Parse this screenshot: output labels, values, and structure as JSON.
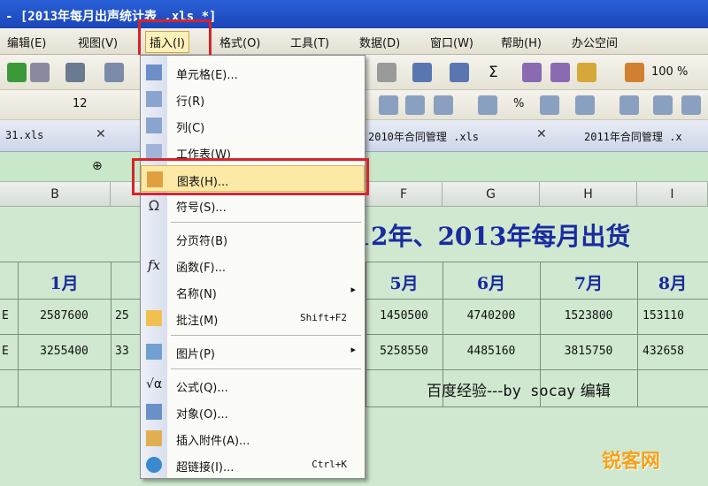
{
  "window": {
    "title": "- [2013年每月出声统计表 .xls *]"
  },
  "menubar": {
    "items": [
      "编辑(E)",
      "视图(V)",
      "插入(I)",
      "格式(O)",
      "工具(T)",
      "数据(D)",
      "窗口(W)",
      "帮助(H)",
      "办公空间"
    ]
  },
  "toolbar": {
    "sigma": "Σ",
    "zoom": "100 %",
    "font_size": "12",
    "percent": "%"
  },
  "tabs": [
    {
      "label": "31.xls"
    },
    {
      "label": "2010年合同管理 .xls"
    },
    {
      "label": "2011年合同管理 .x"
    }
  ],
  "insert_menu": {
    "items": [
      {
        "label": "单元格(E)...",
        "icon": "cells-icon"
      },
      {
        "label": "行(R)",
        "icon": "row-icon"
      },
      {
        "label": "列(C)",
        "icon": "column-icon"
      },
      {
        "label": "工作表(W)",
        "icon": "worksheet-icon"
      },
      {
        "label": "图表(H)...",
        "icon": "chart-icon",
        "highlighted": true
      },
      {
        "label": "符号(S)...",
        "icon": "omega-icon"
      },
      {
        "label": "分页符(B)",
        "icon": ""
      },
      {
        "label": "函数(F)...",
        "icon": "function-icon"
      },
      {
        "label": "名称(N)",
        "icon": "",
        "submenu": true
      },
      {
        "label": "批注(M)",
        "icon": "comment-icon",
        "shortcut": "Shift+F2"
      },
      {
        "label": "图片(P)",
        "icon": "picture-icon",
        "submenu": true
      },
      {
        "label": "公式(Q)...",
        "icon": "formula-icon"
      },
      {
        "label": "对象(O)...",
        "icon": "object-icon"
      },
      {
        "label": "插入附件(A)...",
        "icon": "attachment-icon"
      },
      {
        "label": "超链接(I)...",
        "icon": "hyperlink-icon",
        "shortcut": "Ctrl+K"
      }
    ]
  },
  "grid": {
    "columns": [
      "B",
      "F",
      "G",
      "H",
      "I"
    ],
    "title": "012年、2013年每月出货",
    "months": [
      "1月",
      "5月",
      "6月",
      "7月",
      "8月"
    ],
    "row1": {
      "label": "E",
      "values": [
        "2587600",
        "25",
        "1450500",
        "4740200",
        "1523800",
        "153110"
      ]
    },
    "row2": {
      "label": "E",
      "values": [
        "3255400",
        "33",
        "5258550",
        "4485160",
        "3815750",
        "432658"
      ]
    },
    "credit_a": "百度经验---",
    "credit_b": "by socay",
    "credit_c": "编辑"
  },
  "watermark": "锐客网",
  "colors": {
    "highlight_border": "#d8232a",
    "title_blue": "#1a2aa0",
    "sheet_green": "#cfe8cf"
  }
}
